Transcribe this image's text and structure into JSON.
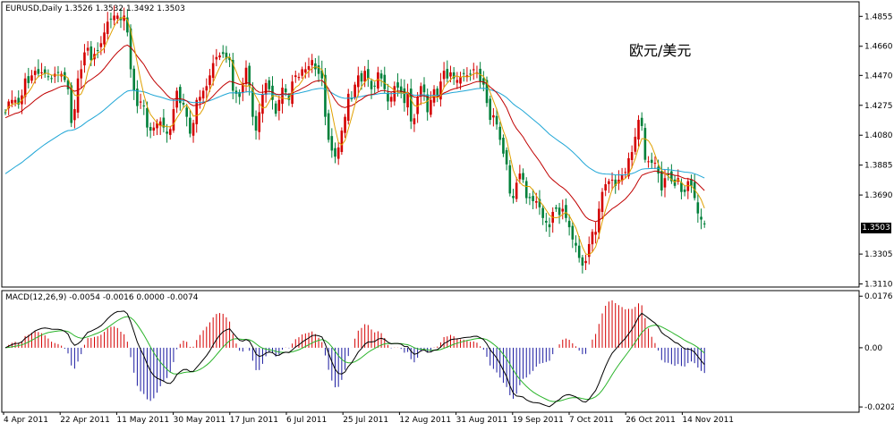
{
  "chart_data": [
    {
      "type": "candlestick",
      "symbol": "EURUSD",
      "timeframe": "Daily",
      "title": "EURUSD,Daily  1.3526 1.3532 1.3492 1.3503",
      "ohlc_last": {
        "open": 1.3526,
        "high": 1.3532,
        "low": 1.3492,
        "close": 1.3503
      },
      "label_cn": "欧元/美元",
      "current_price_label": "1.3503",
      "current_price": 1.3503,
      "ylim": [
        1.309,
        1.495
      ],
      "yticks": [
        1.4855,
        1.466,
        1.447,
        1.4275,
        1.408,
        1.3885,
        1.369,
        1.3305,
        1.311
      ],
      "ytick_labels": [
        "1.4855",
        "1.4660",
        "1.4470",
        "1.4275",
        "1.4080",
        "1.3885",
        "1.3690",
        "1.3305",
        "1.3110"
      ],
      "x_dates": [
        "4 Apr 2011",
        "22 Apr 2011",
        "11 May 2011",
        "30 May 2011",
        "17 Jun 2011",
        "6 Jul 2011",
        "25 Jul 2011",
        "12 Aug 2011",
        "31 Aug 2011",
        "19 Sep 2011",
        "7 Oct 2011",
        "26 Oct 2011",
        "14 Nov 2011"
      ],
      "closes": [
        1.423,
        1.43,
        1.431,
        1.431,
        1.428,
        1.434,
        1.445,
        1.442,
        1.447,
        1.45,
        1.448,
        1.449,
        1.448,
        1.446,
        1.445,
        1.448,
        1.449,
        1.448,
        1.444,
        1.438,
        1.416,
        1.425,
        1.445,
        1.451,
        1.462,
        1.465,
        1.457,
        1.461,
        1.463,
        1.468,
        1.475,
        1.482,
        1.484,
        1.486,
        1.486,
        1.483,
        1.486,
        1.475,
        1.451,
        1.437,
        1.427,
        1.43,
        1.427,
        1.413,
        1.411,
        1.413,
        1.416,
        1.417,
        1.413,
        1.409,
        1.412,
        1.425,
        1.437,
        1.429,
        1.428,
        1.42,
        1.409,
        1.416,
        1.431,
        1.433,
        1.437,
        1.44,
        1.447,
        1.455,
        1.459,
        1.46,
        1.461,
        1.458,
        1.457,
        1.437,
        1.435,
        1.433,
        1.442,
        1.452,
        1.44,
        1.42,
        1.411,
        1.423,
        1.435,
        1.442,
        1.438,
        1.431,
        1.422,
        1.431,
        1.439,
        1.436,
        1.431,
        1.443,
        1.447,
        1.446,
        1.451,
        1.451,
        1.453,
        1.457,
        1.451,
        1.448,
        1.445,
        1.42,
        1.405,
        1.398,
        1.394,
        1.4,
        1.411,
        1.42,
        1.435,
        1.432,
        1.441,
        1.447,
        1.443,
        1.45,
        1.445,
        1.438,
        1.44,
        1.449,
        1.445,
        1.438,
        1.43,
        1.433,
        1.44,
        1.439,
        1.436,
        1.429,
        1.436,
        1.417,
        1.419,
        1.433,
        1.44,
        1.436,
        1.423,
        1.431,
        1.438,
        1.434,
        1.443,
        1.45,
        1.445,
        1.449,
        1.445,
        1.444,
        1.446,
        1.448,
        1.447,
        1.448,
        1.451,
        1.449,
        1.443,
        1.441,
        1.429,
        1.418,
        1.421,
        1.415,
        1.405,
        1.396,
        1.389,
        1.37,
        1.367,
        1.377,
        1.383,
        1.379,
        1.367,
        1.367,
        1.365,
        1.365,
        1.361,
        1.354,
        1.351,
        1.348,
        1.358,
        1.36,
        1.356,
        1.36,
        1.354,
        1.348,
        1.34,
        1.336,
        1.328,
        1.323,
        1.326,
        1.337,
        1.345,
        1.345,
        1.36,
        1.371,
        1.376,
        1.378,
        1.379,
        1.375,
        1.379,
        1.382,
        1.384,
        1.393,
        1.397,
        1.407,
        1.418,
        1.414,
        1.392,
        1.391,
        1.39,
        1.39,
        1.383,
        1.372,
        1.38,
        1.382,
        1.378,
        1.375,
        1.38,
        1.371,
        1.371,
        1.378,
        1.375,
        1.367,
        1.357,
        1.353,
        1.35
      ],
      "ma_fast_color": "#e0a000",
      "ma_mid_color": "#c00000",
      "ma_slow_color": "#1fa6d6",
      "bull_color": "#d40000",
      "bear_color": "#00803a",
      "ma_slow_start": 1.3815,
      "ma_mid_start": 1.419
    },
    {
      "type": "macd",
      "title": "MACD(12,26,9) -0.0054 -0.0016 0.0000 -0.0074",
      "params": [
        12,
        26,
        9
      ],
      "values": [
        -0.0054,
        -0.0016,
        0.0,
        -0.0074
      ],
      "ylim": [
        -0.022,
        0.0195
      ],
      "yticks": [
        0.0176,
        0.0,
        -0.0202
      ],
      "ytick_labels": [
        "0.0176",
        "0.00",
        "-0.0202"
      ],
      "macd_line_color": "#000000",
      "signal_line_color": "#2ab42a",
      "hist_pos_color": "#d40000",
      "hist_neg_color": "#1a1aa0"
    }
  ]
}
